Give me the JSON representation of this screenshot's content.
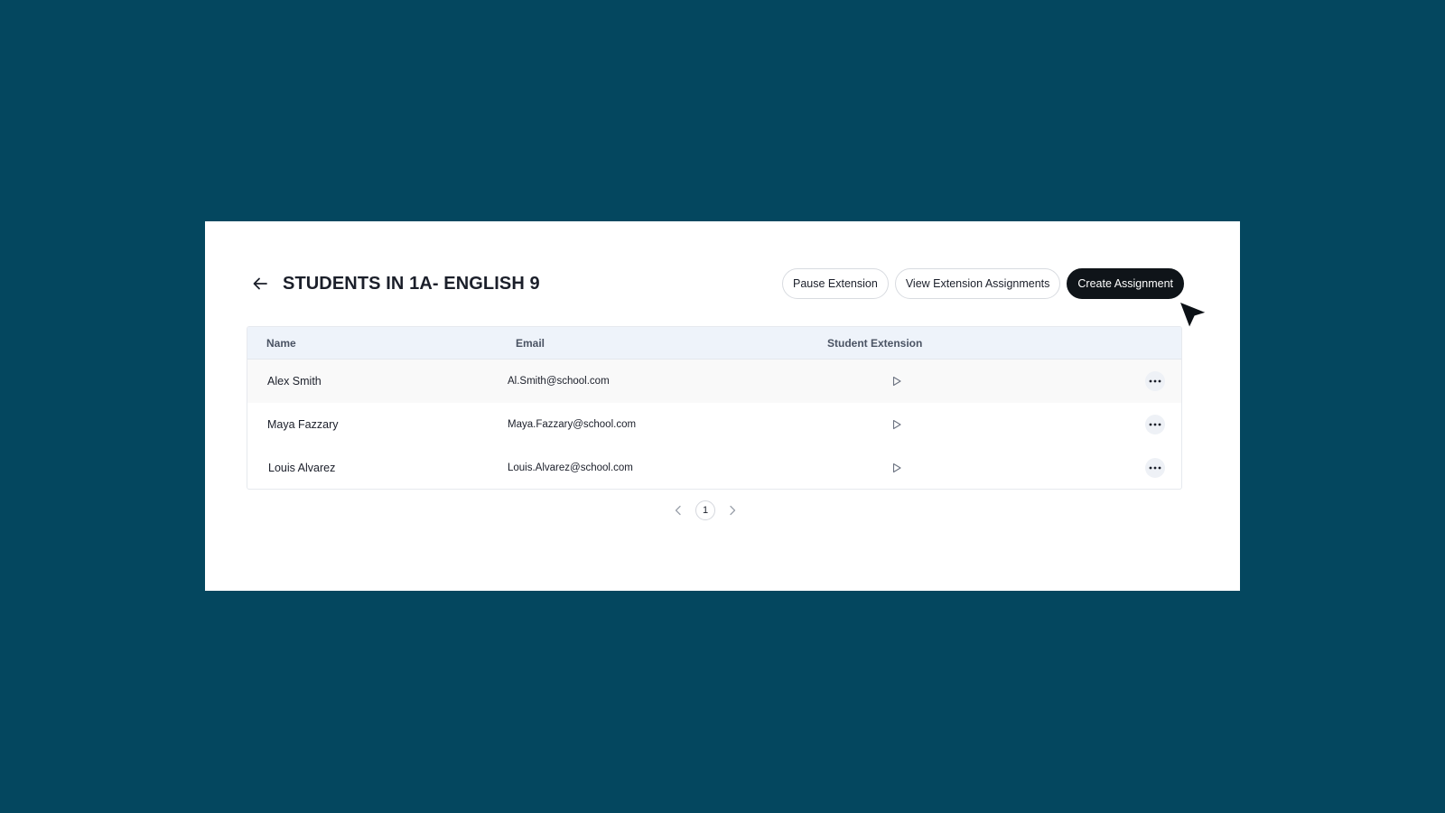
{
  "header": {
    "title": "STUDENTS IN 1A- ENGLISH 9",
    "back_icon": "arrow-left-icon"
  },
  "actions": {
    "pause_label": "Pause Extension",
    "view_label": "View Extension Assignments",
    "create_label": "Create Assignment"
  },
  "table": {
    "columns": [
      "Name",
      "Email",
      "Student Extension"
    ],
    "rows": [
      {
        "name": "Alex Smith",
        "email": "Al.Smith@school.com"
      },
      {
        "name": "Maya Fazzary",
        "email": "Maya.Fazzary@school.com"
      },
      {
        "name": "Louis Alvarez",
        "email": "Louis.Alvarez@school.com"
      }
    ]
  },
  "pagination": {
    "current_page": "1",
    "prev_icon": "chevron-left-icon",
    "next_icon": "chevron-right-icon"
  },
  "colors": {
    "background": "#04475f",
    "primary_button": "#0f1419",
    "table_header": "#eef3fa"
  }
}
